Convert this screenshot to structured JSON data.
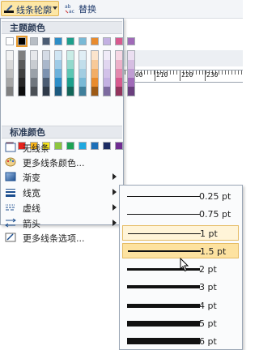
{
  "toolbar": {
    "outline_label": "线条轮廓",
    "replace_label": "替换",
    "outline_icon": "pen-outline-icon",
    "replace_icon": "replace-icon"
  },
  "ruler": {
    "labels": [
      "200",
      "210",
      "220",
      "230"
    ]
  },
  "menu": {
    "theme_header": "主题颜色",
    "standard_header": "标准颜色",
    "theme_top": [
      "#ffffff",
      "#000000",
      "#b7bdc4",
      "#4b5c73",
      "#2d8ec7",
      "#1c9f8c",
      "#79b9d6",
      "#e88b2e",
      "#c3b1e2",
      "#d75a8e",
      "#a06ab8"
    ],
    "selected_index": 1,
    "theme_shades": [
      [
        "#f2f2f2",
        "#d9d9d9",
        "#bfbfbf",
        "#a6a6a6",
        "#808080"
      ],
      [
        "#7f7f7f",
        "#595959",
        "#404040",
        "#262626",
        "#0d0d0d"
      ],
      [
        "#e6e8eb",
        "#c8ccd1",
        "#9aa1a9",
        "#6f767e",
        "#4a4f55"
      ],
      [
        "#d4dbe5",
        "#a9b7cb",
        "#7c92b0",
        "#4b5c73",
        "#2f3a49"
      ],
      [
        "#cfe5f3",
        "#9ecbe7",
        "#6cb1db",
        "#2d8ec7",
        "#1c5a7f"
      ],
      [
        "#c9ece6",
        "#93d9cd",
        "#5cc6b3",
        "#1c9f8c",
        "#126659"
      ],
      [
        "#e0eef5",
        "#c1deeb",
        "#a2cde1",
        "#79b9d6",
        "#3f7f9b"
      ],
      [
        "#fbe4cc",
        "#f7c999",
        "#f2ad66",
        "#e88b2e",
        "#9d5a16"
      ],
      [
        "#f0ebf8",
        "#e1d6f0",
        "#d2c2e9",
        "#c3b1e2",
        "#7d6ba0"
      ],
      [
        "#f6d8e4",
        "#edb1c9",
        "#e388ad",
        "#d75a8e",
        "#93345c"
      ],
      [
        "#ebdff1",
        "#d6bee2",
        "#c09dd3",
        "#a06ab8",
        "#6a3f7e"
      ]
    ],
    "standard": [
      "#c0141f",
      "#e5231c",
      "#f7b31a",
      "#f5e21b",
      "#8dc63f",
      "#1ea354",
      "#1fa9e0",
      "#1d6fb8",
      "#1b2b63",
      "#6f2c91"
    ],
    "items": [
      {
        "label": "无线条",
        "icon": "no-line-icon",
        "arrow": false
      },
      {
        "label": "更多线条颜色...",
        "icon": "palette-icon",
        "arrow": false
      },
      {
        "label": "渐变",
        "icon": "gradient-icon",
        "arrow": true
      },
      {
        "label": "线宽",
        "icon": "line-weight-icon",
        "arrow": true
      },
      {
        "label": "虚线",
        "icon": "dash-icon",
        "arrow": true
      },
      {
        "label": "箭头",
        "icon": "arrow-style-icon",
        "arrow": true
      },
      {
        "label": "更多线条选项...",
        "icon": "line-options-icon",
        "arrow": false
      }
    ],
    "hover_index": 3
  },
  "weights": {
    "options": [
      {
        "label": "0.25 pt",
        "value": 0.25
      },
      {
        "label": "0.75 pt",
        "value": 0.75
      },
      {
        "label": "1 pt",
        "value": 1
      },
      {
        "label": "1.5 pt",
        "value": 1.5
      },
      {
        "label": "2 pt",
        "value": 2
      },
      {
        "label": "3 pt",
        "value": 3
      },
      {
        "label": "4 pt",
        "value": 4
      },
      {
        "label": "5 pt",
        "value": 5
      },
      {
        "label": "6 pt",
        "value": 6
      }
    ],
    "selected_index": 2,
    "hover_index": 3
  }
}
